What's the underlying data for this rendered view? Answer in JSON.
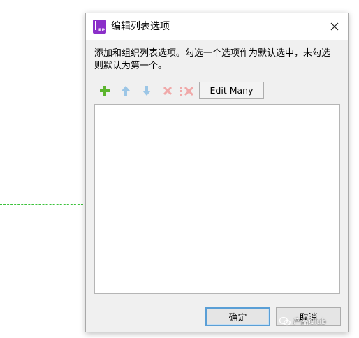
{
  "dialog": {
    "title": "编辑列表选项",
    "app_icon_label": "RP",
    "description": "添加和组织列表选项。勾选一个选项作为默认选中，未勾选则默认为第一个。",
    "toolbar": {
      "add_icon": "plus-icon",
      "move_up_icon": "arrow-up-icon",
      "move_down_icon": "arrow-down-icon",
      "delete_icon": "delete-x-icon",
      "delete_all_icon": "delete-all-icon",
      "edit_many_label": "Edit Many"
    },
    "options": [],
    "buttons": {
      "ok_label": "确定",
      "cancel_label": "取消"
    }
  },
  "watermark": {
    "text": "产品Club"
  },
  "colors": {
    "accent_add": "#5cb52e",
    "disabled_arrow": "#9cc6e6",
    "disabled_delete": "#f0a9a9",
    "app_icon": "#8b2fc9",
    "focus_border": "#5a9fd6",
    "guide_line": "#3cc23c"
  }
}
